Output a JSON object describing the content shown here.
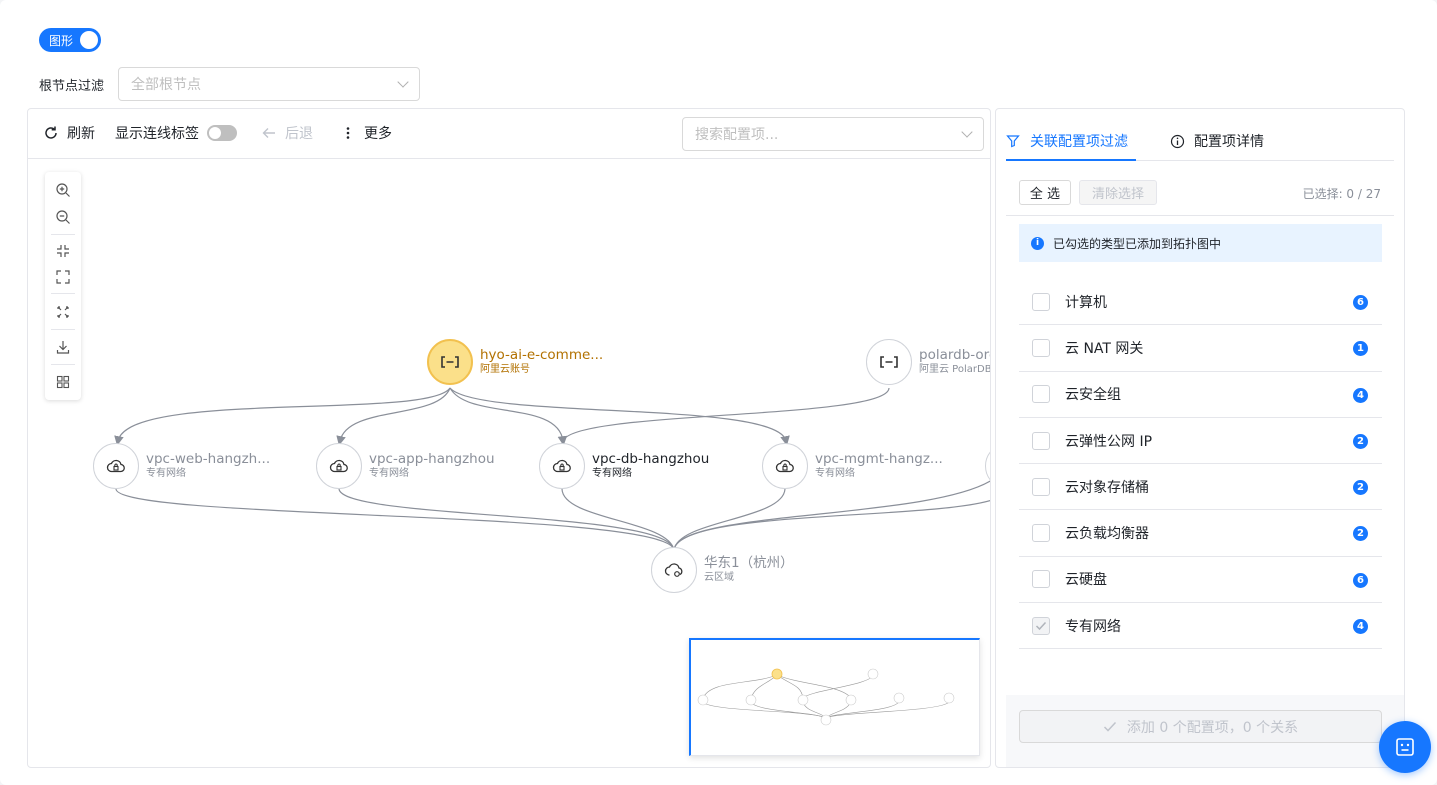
{
  "view_toggle": {
    "label": "图形",
    "on": true
  },
  "root_filter": {
    "label": "根节点过滤",
    "placeholder": "全部根节点"
  },
  "toolbar": {
    "refresh": "刷新",
    "show_edge_labels": "显示连线标签",
    "back": "后退",
    "more": "更多",
    "search_placeholder": "搜索配置项..."
  },
  "graph": {
    "nodes": [
      {
        "id": "account",
        "name": "hyo-ai-e-comme...",
        "type": "阿里云账号",
        "icon": "cloud-account-icon",
        "highlight": true
      },
      {
        "id": "polardb",
        "name": "polardb-ord",
        "type": "阿里云 PolarDB",
        "icon": "cloud-account-icon"
      },
      {
        "id": "vpc-web",
        "name": "vpc-web-hangzh...",
        "type": "专有网络",
        "icon": "vpc-icon"
      },
      {
        "id": "vpc-app",
        "name": "vpc-app-hangzhou",
        "type": "专有网络",
        "icon": "vpc-icon"
      },
      {
        "id": "vpc-db",
        "name": "vpc-db-hangzhou",
        "type": "专有网络",
        "icon": "vpc-icon",
        "active": true
      },
      {
        "id": "vpc-mgmt",
        "name": "vpc-mgmt-hangz...",
        "type": "专有网络",
        "icon": "vpc-icon"
      },
      {
        "id": "region",
        "name": "华东1（杭州）",
        "type": "云区域",
        "icon": "region-icon"
      }
    ]
  },
  "right_panel": {
    "tab_filter": "关联配置项过滤",
    "tab_detail": "配置项详情",
    "select_all": "全 选",
    "clear_selection": "清除选择",
    "selected_count": "已选择: 0 / 27",
    "info": "已勾选的类型已添加到拓扑图中",
    "types": [
      {
        "label": "计算机",
        "count": "6",
        "checked": false
      },
      {
        "label": "云 NAT 网关",
        "count": "1",
        "checked": false
      },
      {
        "label": "云安全组",
        "count": "4",
        "checked": false
      },
      {
        "label": "云弹性公网 IP",
        "count": "2",
        "checked": false
      },
      {
        "label": "云对象存储桶",
        "count": "2",
        "checked": false
      },
      {
        "label": "云负载均衡器",
        "count": "2",
        "checked": false
      },
      {
        "label": "云硬盘",
        "count": "6",
        "checked": false
      },
      {
        "label": "专有网络",
        "count": "4",
        "checked": true
      }
    ],
    "add_button": "添加 0 个配置项，0 个关系"
  },
  "colors": {
    "accent": "#1677ff",
    "highlight_node": "#fbe08a",
    "highlight_text": "#b27100"
  }
}
